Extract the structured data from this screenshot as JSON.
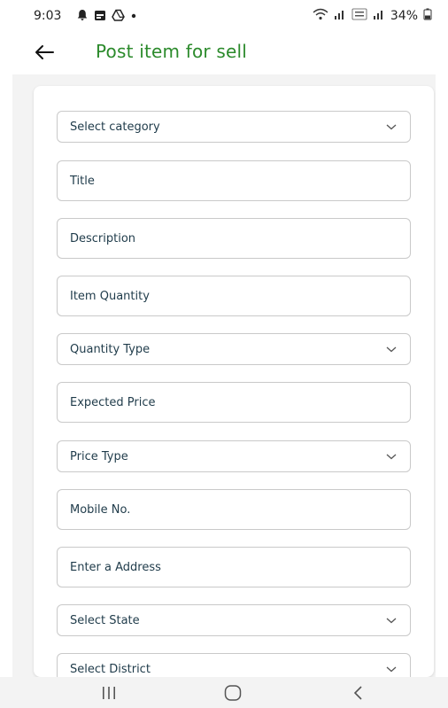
{
  "status_bar": {
    "time": "9:03",
    "battery": "34%",
    "icons_left": [
      "notification-icon",
      "calendar-icon",
      "drive-icon",
      "dot-icon"
    ],
    "icons_right": [
      "wifi-icon",
      "signal-icon",
      "volte-icon",
      "signal-icon",
      "battery-icon"
    ],
    "volte_text": "Vo0 LTE2"
  },
  "app_bar": {
    "title": "Post item for sell",
    "title_color": "#2b8a2b"
  },
  "form": {
    "fields": [
      {
        "label": "Select category",
        "type": "dropdown"
      },
      {
        "label": "Title",
        "type": "text"
      },
      {
        "label": "Description",
        "type": "text"
      },
      {
        "label": "Item Quantity",
        "type": "text"
      },
      {
        "label": "Quantity Type",
        "type": "dropdown"
      },
      {
        "label": "Expected Price",
        "type": "text"
      },
      {
        "label": "Price Type",
        "type": "dropdown"
      },
      {
        "label": "Mobile No.",
        "type": "text"
      },
      {
        "label": "Enter a Address",
        "type": "text"
      },
      {
        "label": "Select State",
        "type": "dropdown"
      },
      {
        "label": "Select District",
        "type": "dropdown"
      }
    ]
  },
  "nav_bar": {
    "buttons": [
      "recents-icon",
      "home-icon",
      "back-nav-icon"
    ]
  }
}
